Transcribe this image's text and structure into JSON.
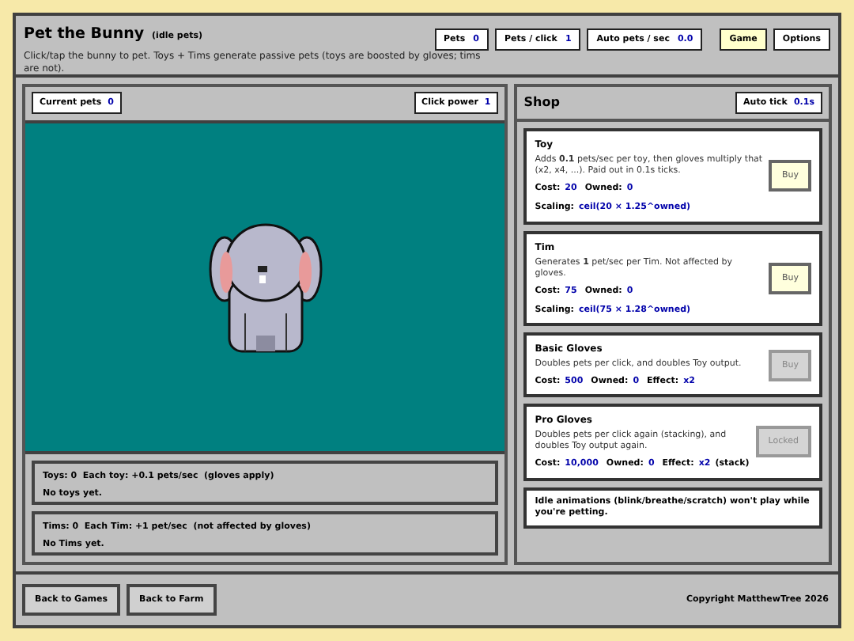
{
  "header": {
    "title": "Pet the Bunny",
    "subtitle": "(idle pets)",
    "description": "Click/tap the bunny to pet. Toys + Tims generate passive pets (toys are boosted by gloves; tims are not).",
    "stats": [
      {
        "label": "Pets",
        "value": "0"
      },
      {
        "label": "Pets / click",
        "value": "1"
      },
      {
        "label": "Auto pets / sec",
        "value": "0.0"
      }
    ],
    "tabs": [
      {
        "label": "Game",
        "selected": true
      },
      {
        "label": "Options",
        "selected": false
      }
    ]
  },
  "play_area": {
    "current_pets": {
      "label": "Current pets",
      "value": "0"
    },
    "click_power": {
      "label": "Click power",
      "value": "1"
    }
  },
  "summaries": [
    {
      "line": "Toys: 0  Each toy: +0.1 pets/sec  (gloves apply)",
      "status": "No toys yet."
    },
    {
      "line": "Tims: 0  Each Tim: +1 pet/sec  (not affected by gloves)",
      "status": "No Tims yet."
    }
  ],
  "shop": {
    "title": "Shop",
    "auto_tick": {
      "label": "Auto tick",
      "value": "0.1s"
    },
    "items": [
      {
        "name": "Toy",
        "description": "Adds **0.1** pets/sec per toy, then gloves multiply that (x2, x4, ...). Paid out in 0.1s ticks.",
        "stats": [
          {
            "label": "Cost:",
            "value": "20"
          },
          {
            "label": "Owned:",
            "value": "0"
          }
        ],
        "scaling": {
          "label": "Scaling:",
          "value": "ceil(20 × 1.25^owned)"
        },
        "button": "Buy",
        "disabled": false
      },
      {
        "name": "Tim",
        "description": "Generates **1** pet/sec per Tim. Not affected by gloves.",
        "stats": [
          {
            "label": "Cost:",
            "value": "75"
          },
          {
            "label": "Owned:",
            "value": "0"
          }
        ],
        "scaling": {
          "label": "Scaling:",
          "value": "ceil(75 × 1.28^owned)"
        },
        "button": "Buy",
        "disabled": false
      },
      {
        "name": "Basic Gloves",
        "description": "Doubles pets per click, and doubles Toy output.",
        "stats": [
          {
            "label": "Cost:",
            "value": "500"
          },
          {
            "label": "Owned:",
            "value": "0"
          },
          {
            "label": "Effect:",
            "value": "x2"
          }
        ],
        "button": "Buy",
        "disabled": true
      },
      {
        "name": "Pro Gloves",
        "description": "Doubles pets per click again (stacking), and doubles Toy output again.",
        "stats": [
          {
            "label": "Cost:",
            "value": "10,000"
          },
          {
            "label": "Owned:",
            "value": "0"
          },
          {
            "label": "Effect:",
            "value": "x2",
            "suffix": "(stack)"
          }
        ],
        "button": "Locked",
        "disabled": true
      }
    ],
    "note": "Idle animations (blink/breathe/scratch) won't play while you're petting."
  },
  "footer": {
    "buttons": [
      "Back to Games",
      "Back to Farm"
    ],
    "copyright": "Copyright MatthewTree 2026"
  }
}
